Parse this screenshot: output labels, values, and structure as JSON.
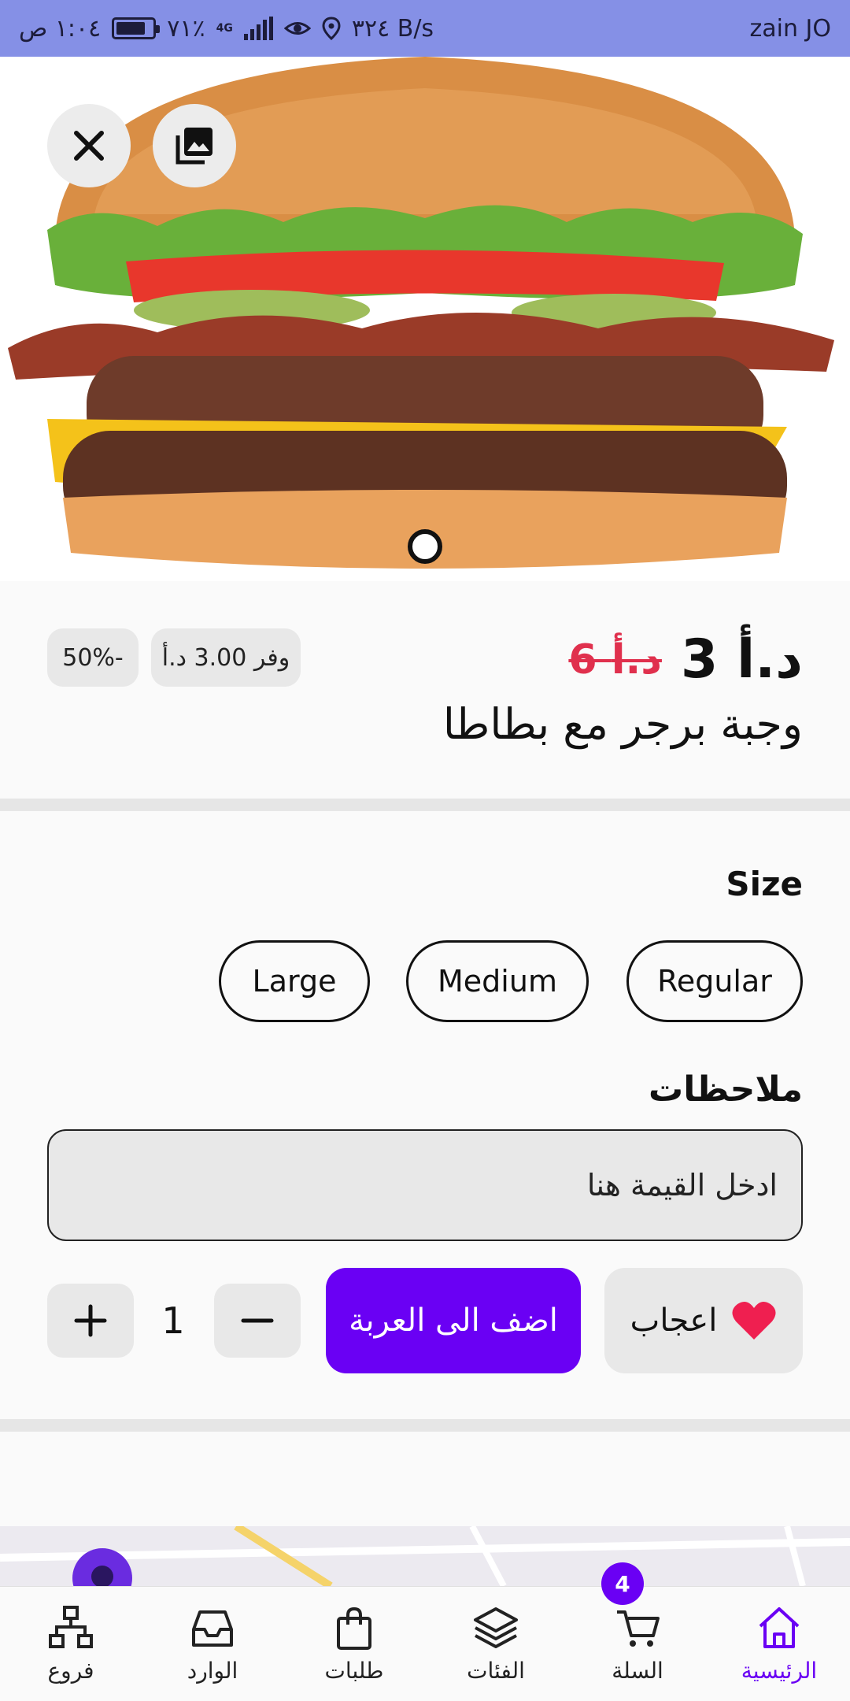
{
  "status_bar": {
    "time": "١:٠٤ ص",
    "battery": "٧١٪",
    "network": "4G",
    "speed": "٣٢٤ B/s",
    "carrier": "zain JO"
  },
  "product": {
    "price_new": "د.أ 3",
    "price_old": "6 د.أ",
    "title": "وجبة برجر مع بطاطا",
    "save_label": "وفر 3.00 د.أ",
    "discount_label": "50%-"
  },
  "size": {
    "title": "Size",
    "options": [
      "Regular",
      "Medium",
      "Large"
    ]
  },
  "notes": {
    "title": "ملاحظات",
    "placeholder": "ادخل القيمة هنا"
  },
  "actions": {
    "like_label": "اعجاب",
    "add_to_cart_label": "اضف الى العربة",
    "quantity": "1"
  },
  "nav": {
    "items": [
      "الرئيسية",
      "السلة",
      "الفئات",
      "طلبات",
      "الوارد",
      "فروع"
    ],
    "cart_count": "4",
    "active_color": "#6a00f4"
  },
  "colors": {
    "accent": "#6a00f4",
    "old_price": "#e0304d",
    "status_bar": "#8590e6"
  }
}
